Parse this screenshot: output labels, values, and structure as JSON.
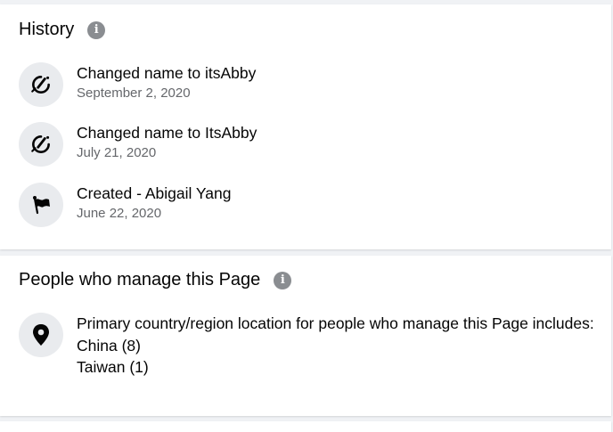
{
  "history": {
    "title": "History",
    "items": [
      {
        "icon": "edit-icon",
        "text": "Changed name to itsAbby",
        "date": "September 2, 2020"
      },
      {
        "icon": "edit-icon",
        "text": "Changed name to ItsAbby",
        "date": "July 21, 2020"
      },
      {
        "icon": "flag-icon",
        "text": "Created - Abigail Yang",
        "date": "June 22, 2020"
      }
    ]
  },
  "managers": {
    "title": "People who manage this Page",
    "location_text": "Primary country/region location for people who manage this Page includes:",
    "countries": [
      "China (8)",
      "Taiwan (1)"
    ]
  },
  "info_glyph": "i",
  "colors": {
    "background": "#f0f2f5",
    "card": "#ffffff",
    "icon_circle": "#e9ebee",
    "info_icon": "#8a8d91",
    "primary_text": "#050505",
    "secondary_text": "#65676b"
  }
}
